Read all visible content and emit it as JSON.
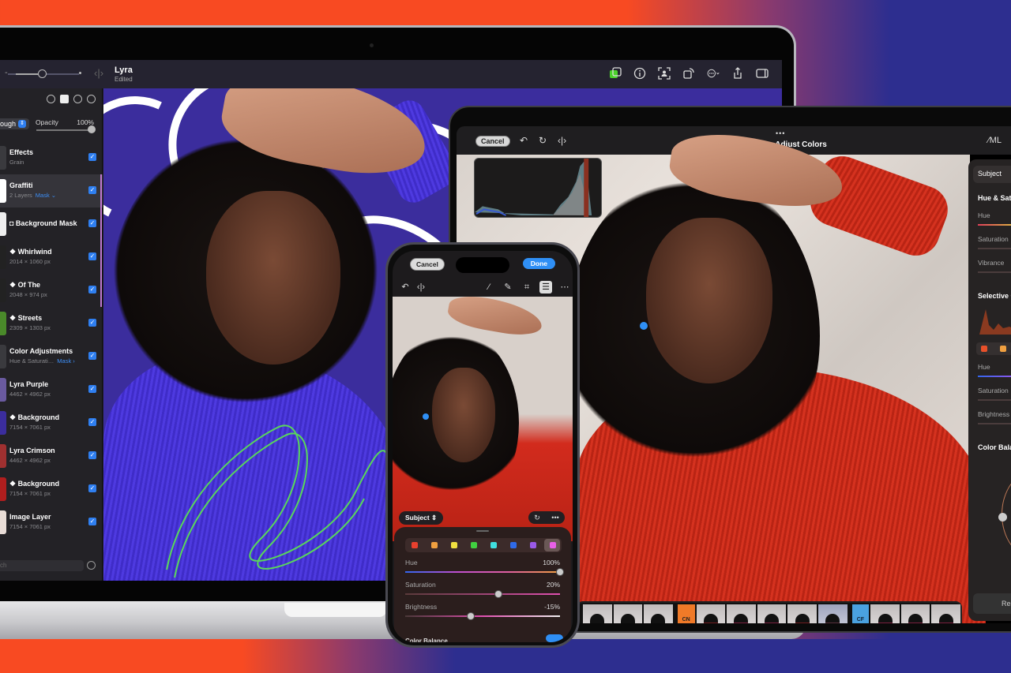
{
  "scene": {
    "background_colors": [
      "#f84a22",
      "#2d2e8f"
    ]
  },
  "mac": {
    "toolbar": {
      "zoom_minus": "-",
      "compare_icon": "‹|›",
      "document_title": "Lyra",
      "document_status": "Edited",
      "tools": [
        {
          "icon": "layers-color-icon",
          "glyph": "▣"
        },
        {
          "icon": "info-icon",
          "glyph": "ⓘ"
        },
        {
          "icon": "select-subject-icon",
          "glyph": "⌗"
        },
        {
          "icon": "crop-rotate-icon",
          "glyph": "⧉"
        },
        {
          "icon": "more-menu-icon",
          "glyph": "⋯⌄"
        },
        {
          "icon": "share-icon",
          "glyph": "⇪"
        },
        {
          "icon": "sidebar-icon",
          "glyph": "▭"
        }
      ]
    },
    "layers_panel": {
      "blend_mode": "ough",
      "opacity_label": "Opacity",
      "opacity_value": "100%",
      "search_placeholder": "ch",
      "layers": [
        {
          "name": "Effects",
          "sub": "Grain",
          "mask": "",
          "checked": true,
          "thumb": "#3a3a3e"
        },
        {
          "name": "Graffiti",
          "sub": "2 Layers",
          "mask": "Mask ⌄",
          "checked": true,
          "thumb": "#fff",
          "selected": true
        },
        {
          "name": "◘ Background Mask",
          "sub": "",
          "mask": "",
          "checked": true,
          "thumb": "#eee"
        },
        {
          "name": "❖ Whirlwind",
          "sub": "2014 × 1060 px",
          "mask": "",
          "checked": true,
          "thumb": "#222"
        },
        {
          "name": "❖ Of The",
          "sub": "2048 × 974 px",
          "mask": "",
          "checked": true,
          "thumb": "#222"
        },
        {
          "name": "❖ Streets",
          "sub": "2309 × 1303 px",
          "mask": "",
          "checked": true,
          "thumb": "#4a8a2a"
        },
        {
          "name": "Color Adjustments",
          "sub": "Hue & Saturati…",
          "mask": "Mask ›",
          "checked": true,
          "thumb": "#3a3a3e"
        },
        {
          "name": "Lyra Purple",
          "sub": "4462 × 4962 px",
          "mask": "",
          "checked": true,
          "thumb": "#6a5aa0"
        },
        {
          "name": "❖ Background",
          "sub": "7154 × 7061 px",
          "mask": "",
          "checked": true,
          "thumb": "#3b2d9d"
        },
        {
          "name": "Lyra Crimson",
          "sub": "4462 × 4962 px",
          "mask": "",
          "checked": true,
          "thumb": "#a03030"
        },
        {
          "name": "❖ Background",
          "sub": "7154 × 7061 px",
          "mask": "",
          "checked": true,
          "thumb": "#b01e1e"
        },
        {
          "name": "Image Layer",
          "sub": "7154 × 7061 px",
          "mask": "",
          "checked": true,
          "thumb": "#e8dcd6"
        }
      ]
    }
  },
  "ipad": {
    "cancel_label": "Cancel",
    "undo_icon": "↶",
    "redo_icon": "↻",
    "compare_icon": "‹|›",
    "more_dots": "•••",
    "title": "Adjust Colors",
    "ml_icon": "⁄ML",
    "side_panel": {
      "subject_label": "Subject",
      "hue_sat_header": "Hue & Saturation",
      "hue_label": "Hue",
      "saturation_label": "Saturation",
      "vibrance_label": "Vibrance",
      "selective_header": "Selective Color",
      "sel_hue_label": "Hue",
      "sel_saturation_label": "Saturation",
      "sel_brightness_label": "Brightness",
      "color_balance_header": "Color Balance",
      "reset_label": "Reset",
      "swatches": [
        "#e8502a",
        "#f0a040"
      ]
    },
    "presets": {
      "groups": [
        {
          "label": "",
          "style": "bw",
          "count": 3
        },
        {
          "label": "CN",
          "style": "cn",
          "items": [
            "warm",
            "pink",
            "pink",
            "warm",
            "cool"
          ]
        },
        {
          "label": "CF",
          "style": "cf",
          "items": [
            "pink",
            "pink",
            "pink"
          ]
        }
      ]
    }
  },
  "iphone": {
    "cancel_label": "Cancel",
    "done_label": "Done",
    "tools_left": [
      {
        "icon": "undo-icon",
        "glyph": "↶"
      },
      {
        "icon": "compare-icon",
        "glyph": "‹|›"
      }
    ],
    "tools_right": [
      {
        "icon": "ml-wand-icon",
        "glyph": "⁄"
      },
      {
        "icon": "brush-icon",
        "glyph": "✎"
      },
      {
        "icon": "crop-icon",
        "glyph": "⌗"
      },
      {
        "icon": "adjust-icon",
        "glyph": "☰",
        "active": true
      },
      {
        "icon": "more-icon",
        "glyph": "⋯"
      }
    ],
    "subject_label": "Subject ⇕",
    "reset_icon": "↻",
    "more_icon": "•••",
    "swatches": [
      "#e8402e",
      "#f0a040",
      "#f0e040",
      "#40d040",
      "#40e0e0",
      "#2f6ae8",
      "#9a5ae8",
      "#e860e8"
    ],
    "adjustments": [
      {
        "label": "Hue",
        "value": "100%",
        "fraction": 1.0,
        "track": "linear-gradient(90deg,#3366ee,#c050d0,#e060a0,#f0a040)"
      },
      {
        "label": "Saturation",
        "value": "20%",
        "fraction": 0.6,
        "track": "linear-gradient(90deg,#5a3a3a,#e050b0)"
      },
      {
        "label": "Brightness",
        "value": "-15%",
        "fraction": 0.425,
        "track": "linear-gradient(90deg,#4a3838,#e050b0,#f0f0f0)"
      }
    ],
    "bottom_section": "Color Balance"
  }
}
